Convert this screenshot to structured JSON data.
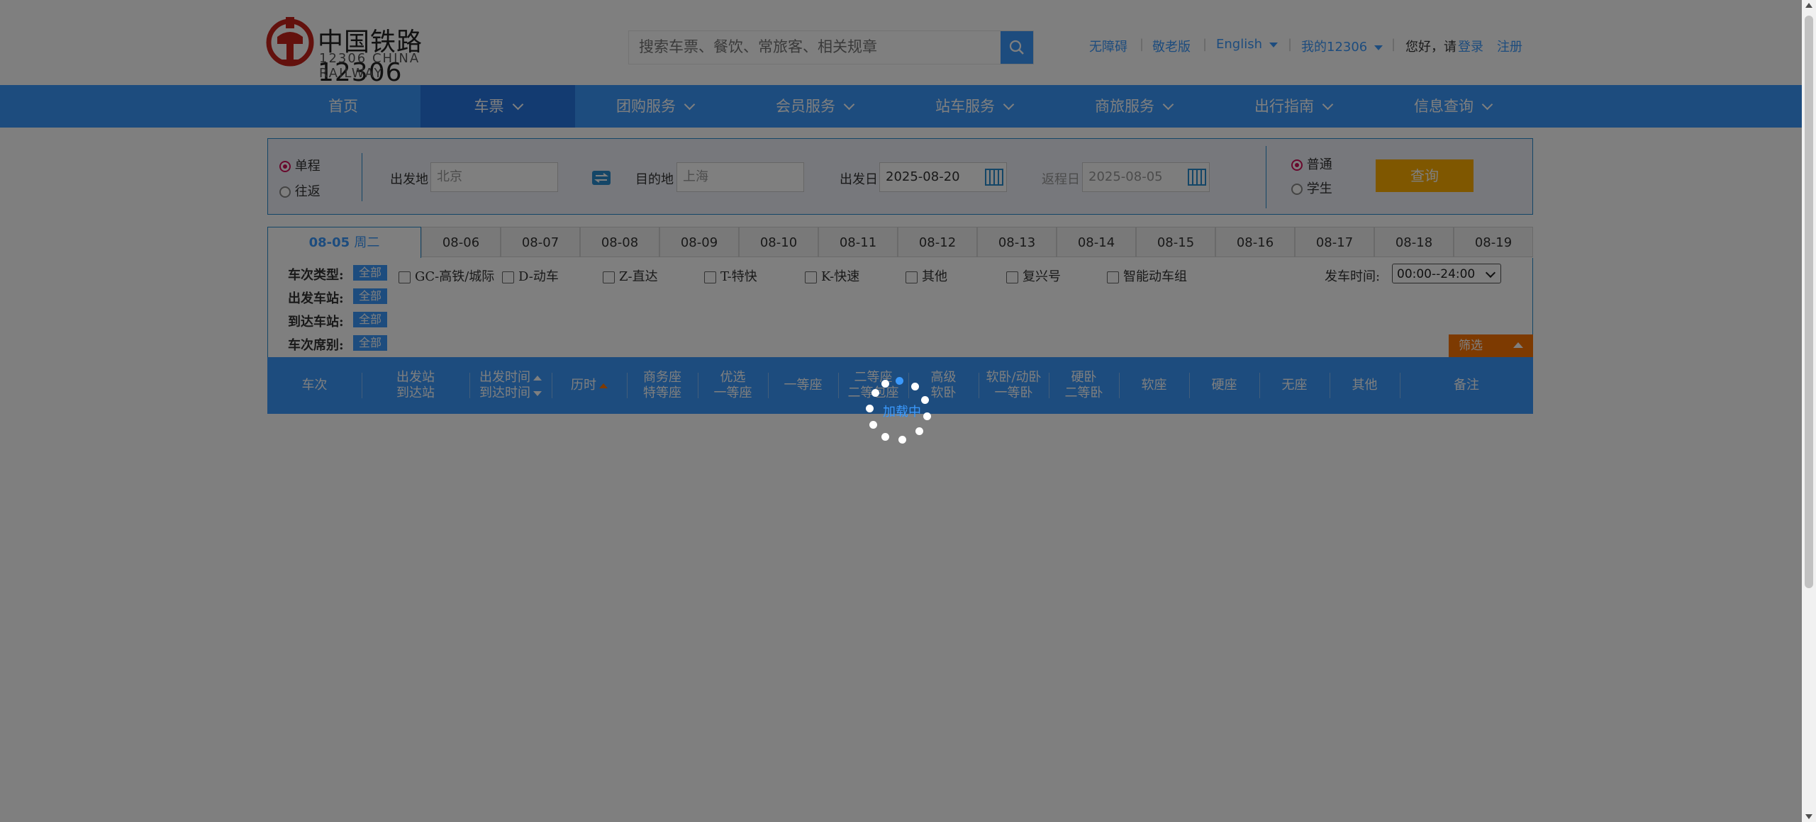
{
  "header": {
    "logo_cn": "中国铁路12306",
    "logo_en": "12306 CHINA RAILWAY",
    "search_placeholder": "搜索车票、餐饮、常旅客、相关规章",
    "links": {
      "accessible": "无障碍",
      "elderly": "敬老版",
      "language": "English",
      "my12306": "我的12306",
      "greeting": "您好，请",
      "login": "登录",
      "register": "注册"
    }
  },
  "mainnav": {
    "items": [
      "首页",
      "车票",
      "团购服务",
      "会员服务",
      "站车服务",
      "商旅服务",
      "出行指南",
      "信息查询"
    ],
    "active_index": 1
  },
  "query": {
    "trip_one_way": "单程",
    "trip_round": "往返",
    "from_label": "出发地",
    "from_value": "北京",
    "to_label": "目的地",
    "to_value": "上海",
    "depart_label": "出发日",
    "depart_value": "2025-08-20",
    "return_label": "返程日",
    "return_value": "2025-08-05",
    "type_normal": "普通",
    "type_student": "学生",
    "submit": "查询"
  },
  "date_tabs": {
    "active_date": "08-05",
    "active_weekday": "周二",
    "dates": [
      "08-06",
      "08-07",
      "08-08",
      "08-09",
      "08-10",
      "08-11",
      "08-12",
      "08-13",
      "08-14",
      "08-15",
      "08-16",
      "08-17",
      "08-18",
      "08-19"
    ]
  },
  "filters": {
    "train_type_label": "车次类型:",
    "from_station_label": "出发车站:",
    "to_station_label": "到达车站:",
    "seat_label": "车次席别:",
    "all": "全部",
    "train_types": [
      "GC-高铁/城际",
      "D-动车",
      "Z-直达",
      "T-特快",
      "K-快速",
      "其他",
      "复兴号",
      "智能动车组"
    ],
    "depart_time_label": "发车时间:",
    "depart_time_value": "00:00--24:00",
    "filter_button": "筛选"
  },
  "table_header": {
    "train": "车次",
    "stations_1": "出发站",
    "stations_2": "到达站",
    "times_1": "出发时间",
    "times_2": "到达时间",
    "duration": "历时",
    "business_1": "商务座",
    "business_2": "特等座",
    "premium_1": "优选",
    "premium_2": "一等座",
    "first": "一等座",
    "second_1": "二等座",
    "second_2": "二等包座",
    "softsleeper_hi_1": "高级",
    "softsleeper_hi_2": "软卧",
    "softsleeper_1": "软卧/动卧",
    "softsleeper_2": "一等卧",
    "hardsleeper_1": "硬卧",
    "hardsleeper_2": "二等卧",
    "softseat": "软座",
    "hardseat": "硬座",
    "noseat": "无座",
    "other": "其他",
    "remarks": "备注"
  },
  "loading": {
    "text": "加载中"
  },
  "colors": {
    "primary": "#3b99fc",
    "nav_active": "#2676e3",
    "orange": "#fb7403",
    "logo_red": "#c7221b"
  }
}
